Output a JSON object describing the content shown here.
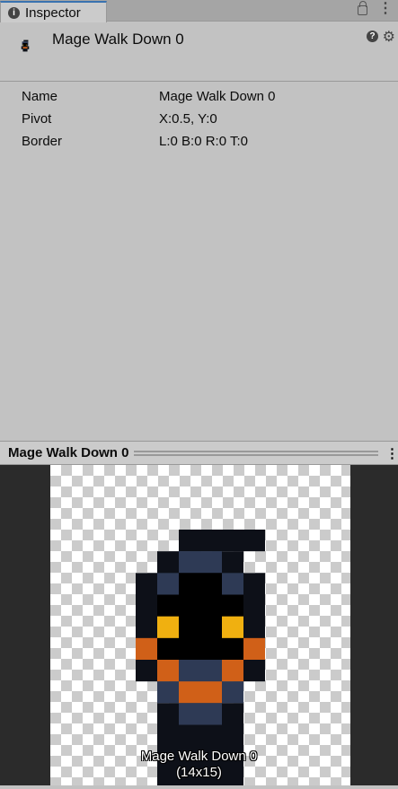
{
  "tab": {
    "label": "Inspector",
    "icon": "info-icon"
  },
  "header": {
    "title": "Mage Walk Down 0"
  },
  "properties": [
    {
      "label": "Name",
      "value": "Mage Walk Down 0"
    },
    {
      "label": "Pivot",
      "value": "X:0.5, Y:0"
    },
    {
      "label": "Border",
      "value": "L:0 B:0 R:0 T:0"
    }
  ],
  "preview": {
    "title": "Mage Walk Down 0",
    "caption_name": "Mage Walk Down 0",
    "caption_size": "(14x15)"
  },
  "colors": {
    "accent": "#3a72b0",
    "sprite_dark": "#0d1018",
    "sprite_blue": "#2e3a55",
    "sprite_orange": "#d06018",
    "sprite_eye": "#f0b010"
  }
}
